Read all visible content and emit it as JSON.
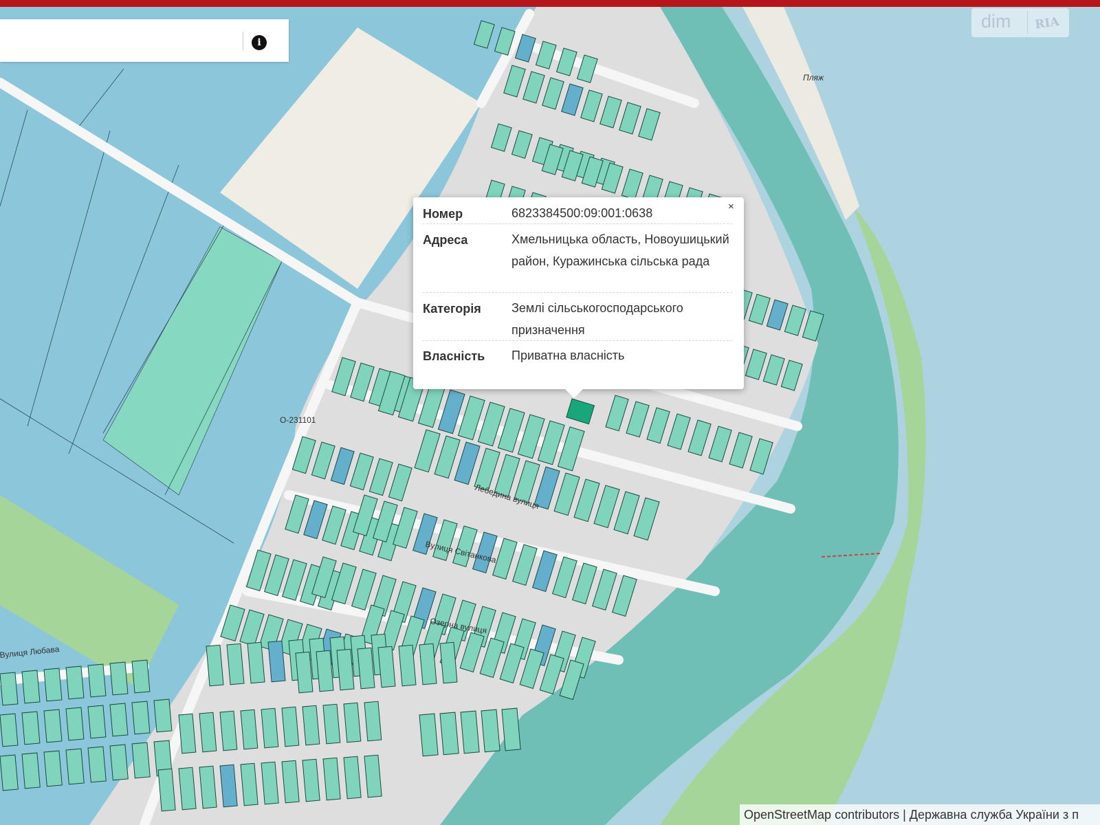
{
  "search": {
    "value": "",
    "placeholder": ""
  },
  "icons": {
    "info": "info-icon",
    "close": "close-icon"
  },
  "logo": {
    "text_dim": "dim",
    "text_ria": "RIA"
  },
  "popup": {
    "close_label": "×",
    "rows": [
      {
        "label": "Номер",
        "value": "6823384500:09:001:0638"
      },
      {
        "label": "Адреса",
        "value": "Хмельницька область, Новоушицький район, Куражинська сільська рада"
      },
      {
        "label": "Категорія",
        "value": "Землі сільськогосподарського призначення"
      },
      {
        "label": "Власність",
        "value": "Приватна власність"
      }
    ]
  },
  "map_labels": {
    "road_code": "О-231101",
    "street_1": "Лебедина вулиця",
    "street_2": "Вулиця Світанкова",
    "street_3": "Озерна вулиця",
    "street_4": "Вулиця Любава",
    "beach": "Пляж"
  },
  "attribution": "OpenStreetMap contributors | Державна служба України з п",
  "colors": {
    "topbar": "#b5151b",
    "water": "#acd3df",
    "plot_green": "#7fd4bb",
    "plot_blue": "#64b0cc",
    "plot_selected": "#17a77b",
    "river_band": "#6fbfb6",
    "field_blue": "#8cc6da",
    "meadow": "#a6d59a"
  }
}
